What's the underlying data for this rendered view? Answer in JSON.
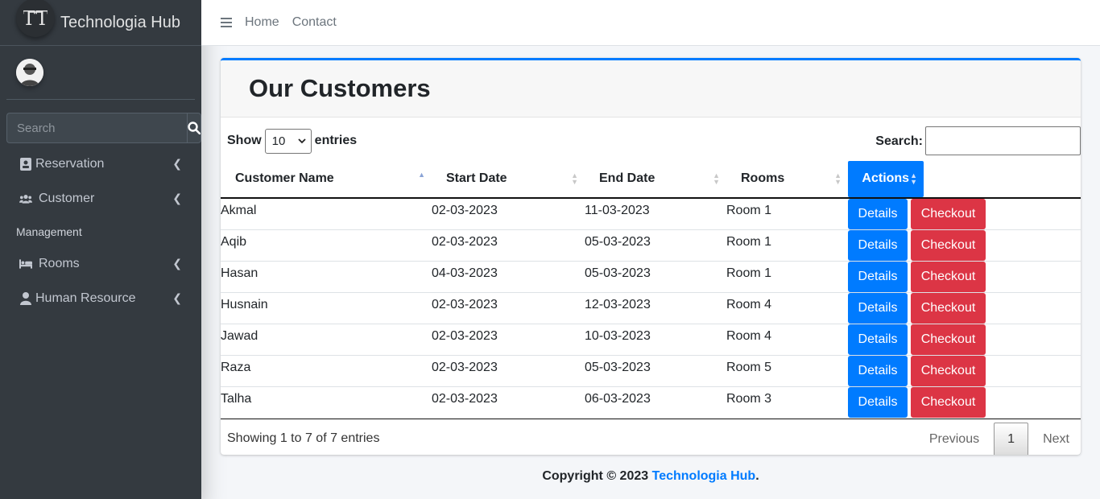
{
  "brand": {
    "name": "Technologia Hub"
  },
  "sidebar": {
    "search_placeholder": "Search",
    "items": [
      {
        "label": "Reservation",
        "icon": "id-card-icon"
      },
      {
        "label": "Customer",
        "icon": "users-icon"
      }
    ],
    "header": "Management",
    "items2": [
      {
        "label": "Rooms",
        "icon": "bed-icon"
      },
      {
        "label": "Human Resource",
        "icon": "user-icon"
      }
    ]
  },
  "topbar": {
    "home": "Home",
    "contact": "Contact"
  },
  "card": {
    "title": "Our Customers",
    "show_label": "Show",
    "entries_label": "entries",
    "length_value": "10",
    "search_label": "Search:",
    "search_value": ""
  },
  "table": {
    "columns": [
      "Customer Name",
      "Start Date",
      "End Date",
      "Rooms",
      "Actions"
    ],
    "rows": [
      {
        "name": "Akmal",
        "start": "02-03-2023",
        "end": "11-03-2023",
        "room": "Room 1"
      },
      {
        "name": "Aqib",
        "start": "02-03-2023",
        "end": "05-03-2023",
        "room": "Room 1"
      },
      {
        "name": "Hasan",
        "start": "04-03-2023",
        "end": "05-03-2023",
        "room": "Room 1"
      },
      {
        "name": "Husnain",
        "start": "02-03-2023",
        "end": "12-03-2023",
        "room": "Room 4"
      },
      {
        "name": "Jawad",
        "start": "02-03-2023",
        "end": "10-03-2023",
        "room": "Room 4"
      },
      {
        "name": "Raza",
        "start": "02-03-2023",
        "end": "05-03-2023",
        "room": "Room 5"
      },
      {
        "name": "Talha",
        "start": "02-03-2023",
        "end": "06-03-2023",
        "room": "Room 3"
      }
    ],
    "details_label": "Details",
    "checkout_label": "Checkout"
  },
  "pagination": {
    "info": "Showing 1 to 7 of 7 entries",
    "previous": "Previous",
    "current": "1",
    "next": "Next"
  },
  "footer": {
    "prefix": "Copyright © 2023",
    "link": "Technologia Hub",
    "suffix": "."
  },
  "colors": {
    "primary": "#007bff",
    "danger": "#dc3545",
    "sidebar": "#343a40"
  }
}
